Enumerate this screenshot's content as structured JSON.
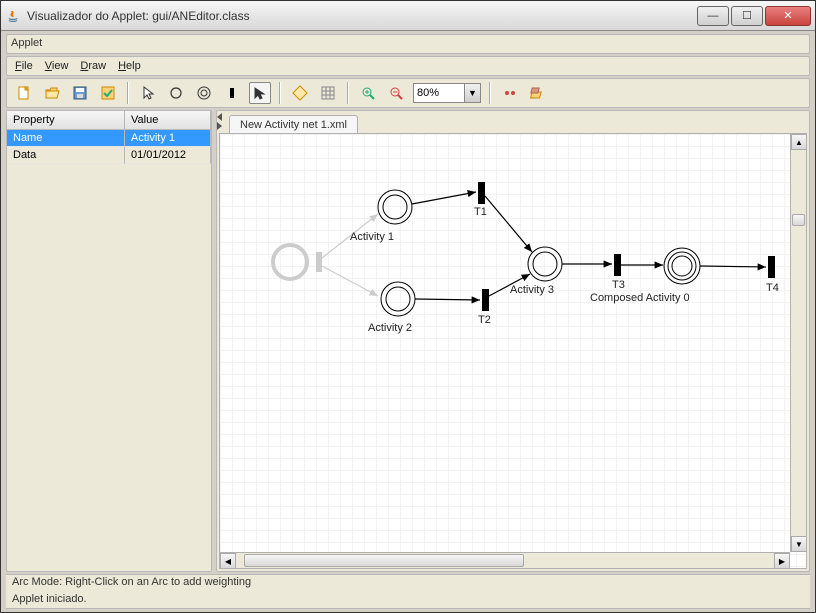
{
  "window": {
    "title": "Visualizador do Applet: gui/ANEditor.class",
    "applet_label": "Applet"
  },
  "menu": {
    "file": "File",
    "view": "View",
    "draw": "Draw",
    "help": "Help"
  },
  "toolbar": {
    "zoom_value": "80%"
  },
  "properties": {
    "header_property": "Property",
    "header_value": "Value",
    "rows": [
      {
        "property": "Name",
        "value": "Activity 1",
        "selected": true
      },
      {
        "property": "Data",
        "value": "01/01/2012",
        "selected": false
      }
    ]
  },
  "tab": {
    "label": "New Activity net 1.xml"
  },
  "net": {
    "activity1": "Activity 1",
    "activity2": "Activity 2",
    "activity3": "Activity 3",
    "composed0": "Composed Activity 0",
    "t1": "T1",
    "t2": "T2",
    "t3": "T3",
    "t4": "T4"
  },
  "status": {
    "mode": "Arc Mode: Right-Click on an Arc to add weighting",
    "applet": "Applet iniciado."
  },
  "colors": {
    "selection": "#3399ff"
  }
}
